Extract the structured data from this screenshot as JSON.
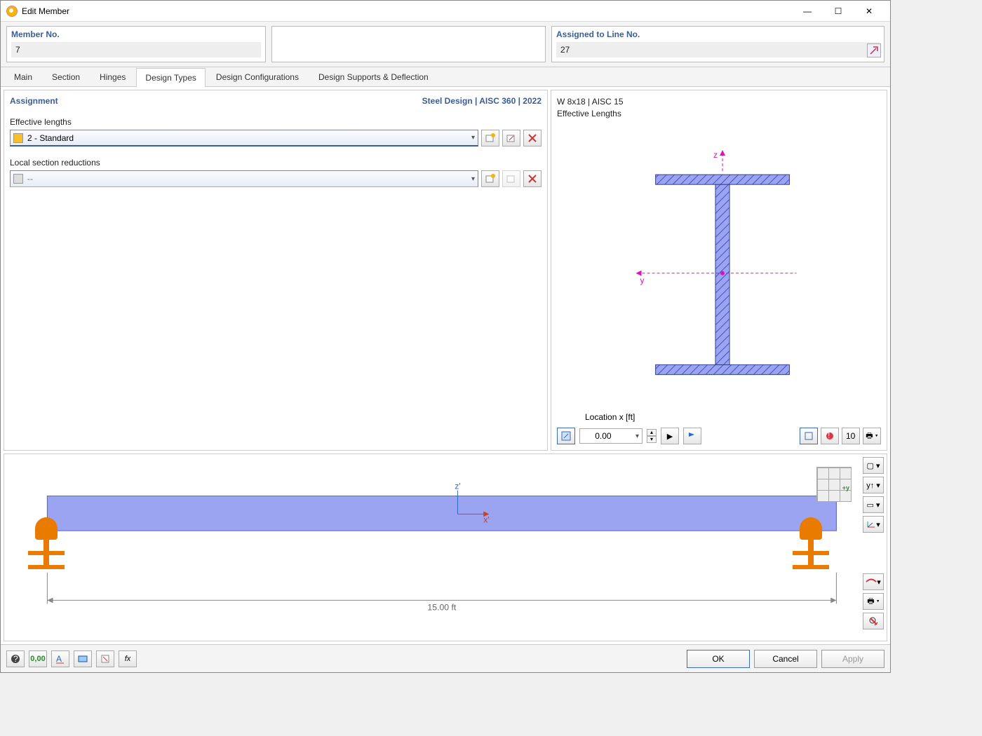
{
  "window": {
    "title": "Edit Member"
  },
  "header": {
    "member_label": "Member No.",
    "member_value": "7",
    "line_label": "Assigned to Line No.",
    "line_value": "27"
  },
  "tabs": [
    {
      "label": "Main"
    },
    {
      "label": "Section"
    },
    {
      "label": "Hinges"
    },
    {
      "label": "Design Types"
    },
    {
      "label": "Design Configurations"
    },
    {
      "label": "Design Supports & Deflection"
    }
  ],
  "active_tab": 3,
  "assignment": {
    "title": "Assignment",
    "link": "Steel Design | AISC 360 | 2022",
    "eff_len_label": "Effective lengths",
    "eff_len_value": "2 - Standard",
    "eff_len_swatch": "#f5c02a",
    "lsr_label": "Local section reductions",
    "lsr_value": "--"
  },
  "preview": {
    "section_name": "W 8x18 | AISC 15",
    "subtitle": "Effective Lengths",
    "axis_z": "z",
    "axis_y": "y",
    "location_label": "Location x [ft]",
    "location_value": "0.00"
  },
  "member_view": {
    "axis_z": "z'",
    "axis_x": "x'",
    "length_label": "15.00 ft",
    "navcube_y": "+y"
  },
  "footer": {
    "ok": "OK",
    "cancel": "Cancel",
    "apply": "Apply"
  },
  "icons": {
    "new": "✚",
    "edit": "✎",
    "del": "✖",
    "pick": "↘",
    "zoom": "🔍",
    "units": "0,00",
    "text": "A",
    "view": "◫",
    "script": "fx",
    "sheet": "▭",
    "arrow": "➵"
  }
}
